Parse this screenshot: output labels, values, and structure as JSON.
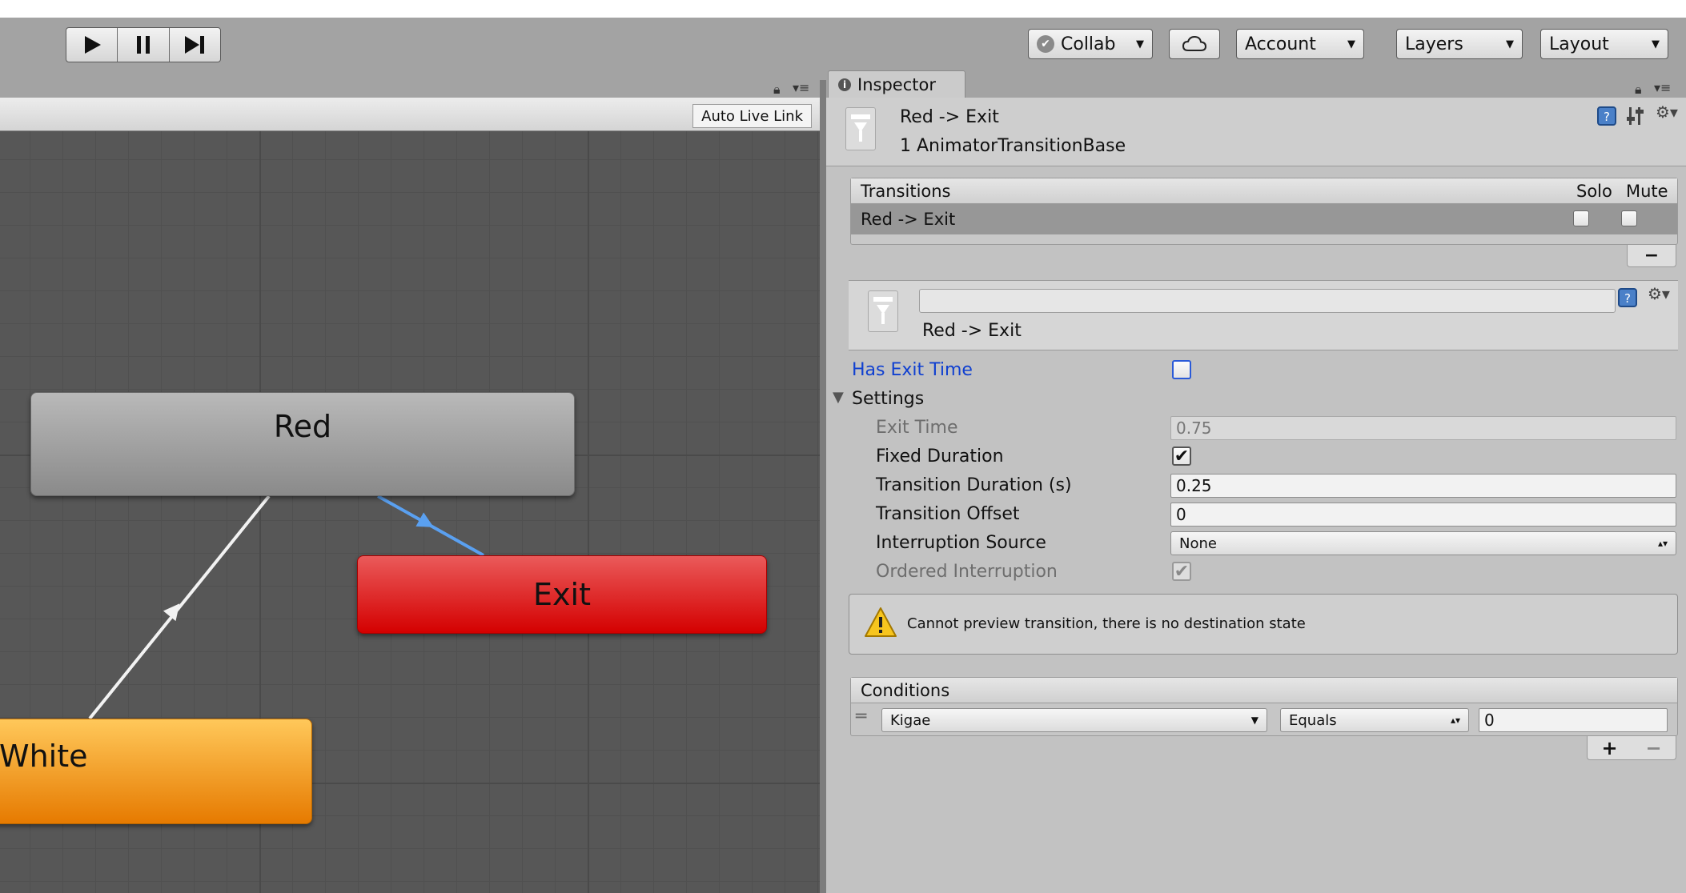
{
  "toolbar": {
    "play_icon": "play-icon",
    "pause_icon": "pause-icon",
    "step_icon": "step-icon",
    "collab_label": "Collab",
    "account_label": "Account",
    "layers_label": "Layers",
    "layout_label": "Layout"
  },
  "animator": {
    "auto_live_link": "Auto Live Link",
    "states": {
      "red": "Red",
      "exit": "Exit",
      "white": "White"
    },
    "colors": {
      "red_state": "#a0a0a0",
      "exit_state": "#e01010",
      "white_state": "#f29a1a",
      "selected_transition": "#5aa0f0"
    }
  },
  "inspector": {
    "tab_label": "Inspector",
    "header_title": "Red -> Exit",
    "header_subtitle": "1 AnimatorTransitionBase",
    "transitions": {
      "header": "Transitions",
      "solo": "Solo",
      "mute": "Mute",
      "rows": [
        {
          "label": "Red -> Exit",
          "solo": false,
          "mute": false
        }
      ]
    },
    "transition_name": "Red -> Exit",
    "has_exit_time": {
      "label": "Has Exit Time",
      "checked": false
    },
    "settings": {
      "label": "Settings",
      "exit_time": {
        "label": "Exit Time",
        "value": "0.75"
      },
      "fixed_duration": {
        "label": "Fixed Duration",
        "checked": true
      },
      "transition_duration": {
        "label": "Transition Duration (s)",
        "value": "0.25"
      },
      "transition_offset": {
        "label": "Transition Offset",
        "value": "0"
      },
      "interruption_source": {
        "label": "Interruption Source",
        "value": "None"
      },
      "ordered_interruption": {
        "label": "Ordered Interruption",
        "checked": true
      }
    },
    "warning": "Cannot preview transition, there is no destination state",
    "conditions": {
      "header": "Conditions",
      "rows": [
        {
          "parameter": "Kigae",
          "mode": "Equals",
          "value": "0"
        }
      ]
    }
  }
}
